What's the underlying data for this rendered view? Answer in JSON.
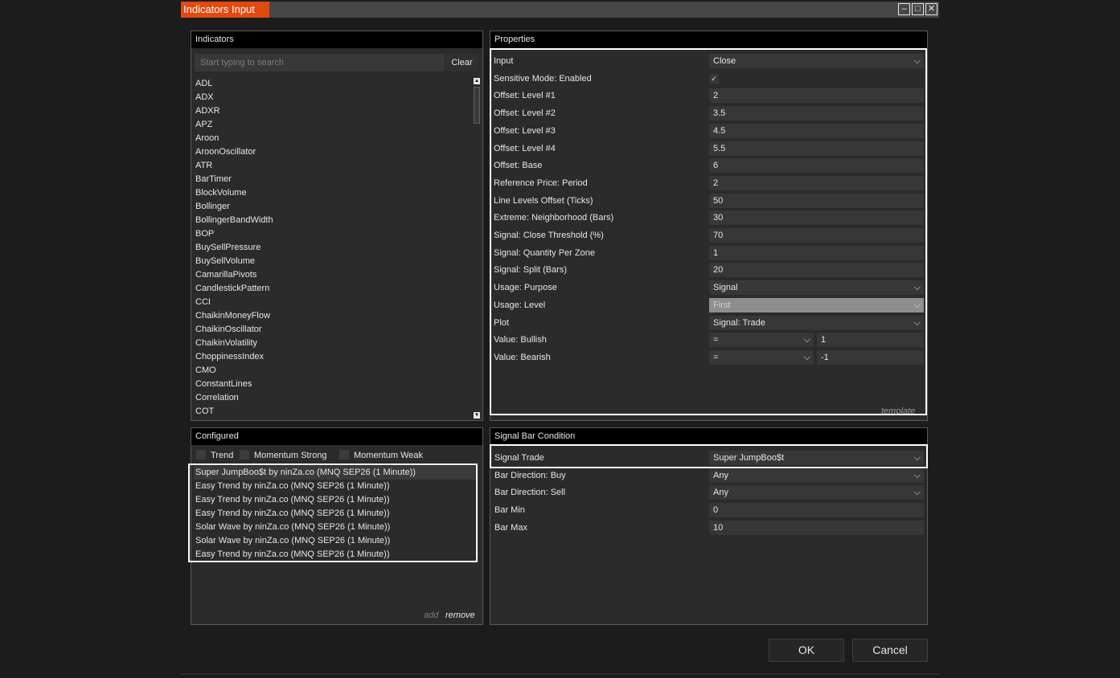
{
  "window": {
    "title": "Indicators Input",
    "controls": [
      "minimize",
      "maximize",
      "close"
    ]
  },
  "indicators_panel": {
    "header": "Indicators",
    "search_placeholder": "Start typing to search",
    "clear_label": "Clear",
    "items": [
      "ADL",
      "ADX",
      "ADXR",
      "APZ",
      "Aroon",
      "AroonOscillator",
      "ATR",
      "BarTimer",
      "BlockVolume",
      "Bollinger",
      "BollingerBandWidth",
      "BOP",
      "BuySellPressure",
      "BuySellVolume",
      "CamarillaPivots",
      "CandlestickPattern",
      "CCI",
      "ChaikinMoneyFlow",
      "ChaikinOscillator",
      "ChaikinVolatility",
      "ChoppinessIndex",
      "CMO",
      "ConstantLines",
      "Correlation",
      "COT"
    ]
  },
  "properties_panel": {
    "header": "Properties",
    "rows": [
      {
        "label": "Input",
        "value": "Close",
        "kind": "select"
      },
      {
        "label": "Sensitive Mode: Enabled",
        "value": "✓",
        "kind": "checkbox"
      },
      {
        "label": "Offset: Level #1",
        "value": "2",
        "kind": "text"
      },
      {
        "label": "Offset: Level #2",
        "value": "3.5",
        "kind": "text"
      },
      {
        "label": "Offset: Level #3",
        "value": "4.5",
        "kind": "text"
      },
      {
        "label": "Offset: Level #4",
        "value": "5.5",
        "kind": "text"
      },
      {
        "label": "Offset: Base",
        "value": "6",
        "kind": "text"
      },
      {
        "label": "Reference Price: Period",
        "value": "2",
        "kind": "text"
      },
      {
        "label": "Line Levels Offset (Ticks)",
        "value": "50",
        "kind": "text"
      },
      {
        "label": "Extreme: Neighborhood (Bars)",
        "value": "30",
        "kind": "text"
      },
      {
        "label": "Signal: Close Threshold (%)",
        "value": "70",
        "kind": "text"
      },
      {
        "label": "Signal: Quantity Per Zone",
        "value": "1",
        "kind": "text"
      },
      {
        "label": "Signal: Split (Bars)",
        "value": "20",
        "kind": "text"
      },
      {
        "label": "Usage: Purpose",
        "value": "Signal",
        "kind": "select"
      },
      {
        "label": "Usage: Level",
        "value": "First",
        "kind": "select-disabled"
      },
      {
        "label": "Plot",
        "value": "Signal: Trade",
        "kind": "select"
      },
      {
        "label": "Value: Bullish",
        "operator": "=",
        "value": "1",
        "kind": "op"
      },
      {
        "label": "Value: Bearish",
        "operator": "=",
        "value": "-1",
        "kind": "op"
      }
    ],
    "template_link": "template"
  },
  "configured_panel": {
    "header": "Configured",
    "filters": [
      "Trend",
      "Momentum Strong",
      "Momentum Weak"
    ],
    "items": [
      "Super JumpBoo$t by ninZa.co (MNQ SEP26 (1 Minute))",
      "Easy Trend by ninZa.co (MNQ SEP26 (1 Minute))",
      "Easy Trend by ninZa.co (MNQ SEP26 (1 Minute))",
      "Easy Trend by ninZa.co (MNQ SEP26 (1 Minute))",
      "Solar Wave by ninZa.co (MNQ SEP26 (1 Minute))",
      "Solar Wave by ninZa.co (MNQ SEP26 (1 Minute))",
      "Easy Trend by ninZa.co (MNQ SEP26 (1 Minute))"
    ],
    "add_label": "add",
    "remove_label": "remove"
  },
  "signal_bar_panel": {
    "header": "Signal Bar Condition",
    "rows": [
      {
        "label": "Signal Trade",
        "value": "Super JumpBoo$t",
        "kind": "select"
      },
      {
        "label": "Bar Direction: Buy",
        "value": "Any",
        "kind": "select"
      },
      {
        "label": "Bar Direction: Sell",
        "value": "Any",
        "kind": "select"
      },
      {
        "label": "Bar Min",
        "value": "0",
        "kind": "text"
      },
      {
        "label": "Bar Max",
        "value": "10",
        "kind": "text"
      }
    ]
  },
  "buttons": {
    "ok": "OK",
    "cancel": "Cancel"
  },
  "colors": {
    "accent": "#e34a10",
    "background": "#1c1c1c",
    "panel": "#2b2b2b",
    "field": "#373737",
    "highlight_border": "#ffffff"
  }
}
